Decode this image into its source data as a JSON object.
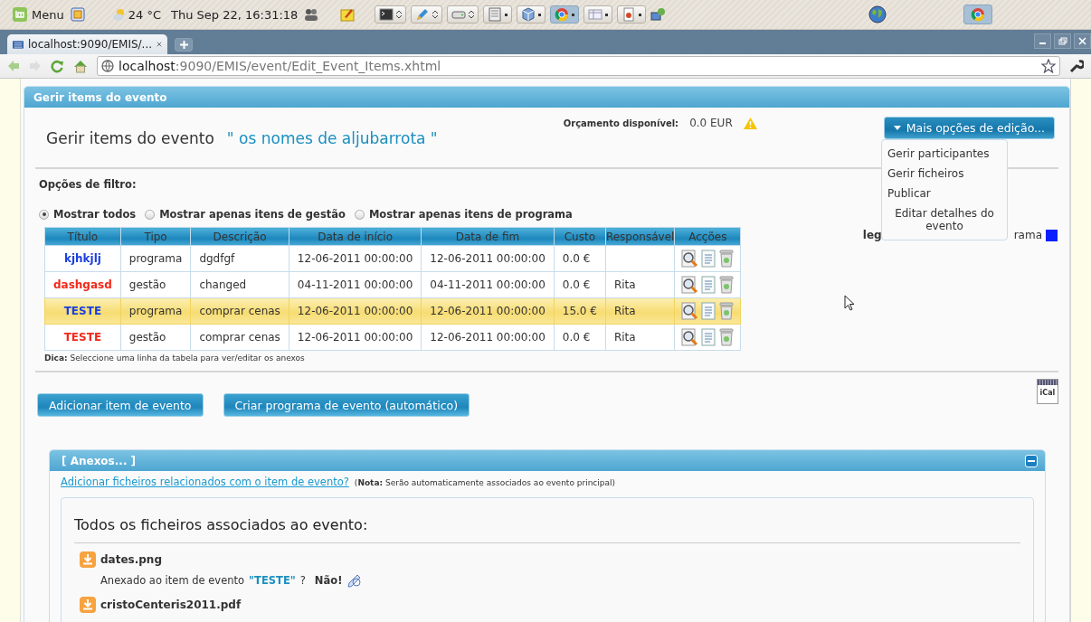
{
  "top_panel": {
    "menu": "Menu",
    "weather": "24 °C",
    "clock": "Thu Sep 22, 16:31:18"
  },
  "browser": {
    "tab_title": "localhost:9090/EMIS/...",
    "url_host": "localhost",
    "url_path": ":9090/EMIS/event/Edit_Event_Items.xhtml"
  },
  "panel_title": "Gerir items do evento",
  "heading": "Gerir items do evento",
  "event_name": "\" os nomes de aljubarrota \"",
  "budget": {
    "label": "Orçamento disponível:",
    "value": "0.0 EUR"
  },
  "more_options": {
    "label": "Mais opções de edição...",
    "expanded": true,
    "items": [
      "Gerir participantes",
      "Gerir ficheiros",
      "Publicar",
      "Editar detalhes do evento"
    ]
  },
  "filter": {
    "label": "Opções de filtro:",
    "options": [
      {
        "label": "Mostrar todos",
        "selected": true
      },
      {
        "label": "Mostrar apenas itens de gestão",
        "selected": false
      },
      {
        "label": "Mostrar apenas itens de programa",
        "selected": false
      }
    ]
  },
  "legend": {
    "label": "leg",
    "text": "rama"
  },
  "table": {
    "columns": [
      "Título",
      "Tipo",
      "Descrição",
      "Data de início",
      "Data de fim",
      "Custo",
      "Responsável",
      "Acções"
    ],
    "rows": [
      {
        "title": "kjhkjlj",
        "color": "#1a3fe0",
        "type": "programa",
        "description": "dgdfgf",
        "start": "12-06-2011 00:00:00",
        "end": "12-06-2011 00:00:00",
        "cost": "0.0 €",
        "responsible": "",
        "selected": false
      },
      {
        "title": "dashgasd",
        "color": "#f02a1a",
        "type": "gestão",
        "description": "changed",
        "start": "04-11-2011 00:00:00",
        "end": "04-11-2011 00:00:00",
        "cost": "0.0 €",
        "responsible": "Rita",
        "selected": false
      },
      {
        "title": "TESTE",
        "color": "#1a3fe0",
        "type": "programa",
        "description": "comprar cenas",
        "start": "12-06-2011 00:00:00",
        "end": "12-06-2011 00:00:00",
        "cost": "15.0 €",
        "responsible": "Rita",
        "selected": true
      },
      {
        "title": "TESTE",
        "color": "#f02a1a",
        "type": "gestão",
        "description": "comprar cenas",
        "start": "12-06-2011 00:00:00",
        "end": "12-06-2011 00:00:00",
        "cost": "0.0 €",
        "responsible": "Rita",
        "selected": false
      }
    ]
  },
  "tip": "**Dica:** Seleccione uma linha da tabela para ver/editar os anexos",
  "buttons": [
    "Adicionar item de evento",
    "Criar programa de evento (automático)"
  ],
  "ical": "iCal",
  "attachments": {
    "title": "[ Anexos... ]",
    "add_link": "Adicionar ficheiros relacionados com o item de evento?",
    "note": "(**Nota:** Serão automaticamente associados ao evento principal)",
    "heading": "Todos os ficheiros associados ao evento:",
    "files": [
      {
        "name": "dates.png",
        "attached_label": "Anexado ao item de evento",
        "item": "\"TESTE\"",
        "question": "?",
        "answer": "Não!"
      },
      {
        "name": "cristoCenteris2011.pdf"
      }
    ]
  }
}
